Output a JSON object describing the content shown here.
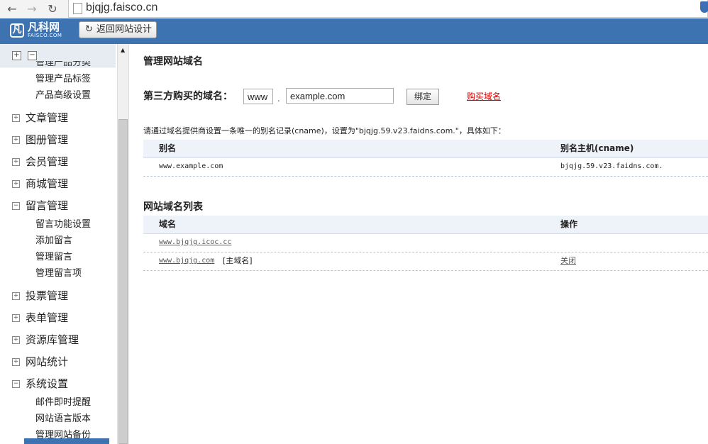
{
  "browser": {
    "url": "bjqjg.faisco.cn",
    "back_icon": "arrow-left-icon",
    "forward_icon": "arrow-right-icon",
    "reload_icon": "reload-icon"
  },
  "header": {
    "logo_text": "凡科网",
    "logo_sub": "FAISCO.COM",
    "back_button_label": "返回网站设计",
    "back_button_icon": "refresh-icon",
    "bar_color": "#3d73b0"
  },
  "sidebar": {
    "cut_item": "管理产品分类",
    "items": [
      {
        "type": "sub",
        "label": "管理产品标签"
      },
      {
        "type": "sub",
        "label": "产品高级设置"
      },
      {
        "type": "cat",
        "label": "文章管理",
        "toggle": "+"
      },
      {
        "type": "cat",
        "label": "图册管理",
        "toggle": "+"
      },
      {
        "type": "cat",
        "label": "会员管理",
        "toggle": "+"
      },
      {
        "type": "cat",
        "label": "商城管理",
        "toggle": "+"
      },
      {
        "type": "cat",
        "label": "留言管理",
        "toggle": "−"
      },
      {
        "type": "sub",
        "label": "留言功能设置"
      },
      {
        "type": "sub",
        "label": "添加留言"
      },
      {
        "type": "sub",
        "label": "管理留言"
      },
      {
        "type": "sub",
        "label": "管理留言项"
      },
      {
        "type": "cat",
        "label": "投票管理",
        "toggle": "+"
      },
      {
        "type": "cat",
        "label": "表单管理",
        "toggle": "+"
      },
      {
        "type": "cat",
        "label": "资源库管理",
        "toggle": "+"
      },
      {
        "type": "cat",
        "label": "网站统计",
        "toggle": "+"
      },
      {
        "type": "cat",
        "label": "系统设置",
        "toggle": "−"
      },
      {
        "type": "sub",
        "label": "邮件即时提醒"
      },
      {
        "type": "sub",
        "label": "网站语言版本"
      },
      {
        "type": "sub",
        "label": "管理网站备份"
      }
    ]
  },
  "main": {
    "title": "管理网站域名",
    "third_party": {
      "label": "第三方购买的域名：",
      "prefix_value": "www",
      "domain_value": "example.com",
      "bind_button": "绑定",
      "buy_link": "购买域名"
    },
    "note": "请通过域名提供商设置一条唯一的别名记录(cname)，设置为\"bjqjg.59.v23.faidns.com.\"，具体如下：",
    "cname_table": {
      "headers": [
        "别名",
        "别名主机(cname)"
      ],
      "rows": [
        [
          "www.example.com",
          "bjqjg.59.v23.faidns.com."
        ]
      ]
    },
    "domain_list": {
      "title": "网站域名列表",
      "headers": [
        "域名",
        "操作"
      ],
      "rows": [
        {
          "domain": "www.bjqjg.icoc.cc",
          "tag": "",
          "action": ""
        },
        {
          "domain": "www.bjqjg.com",
          "tag": "[主域名]",
          "action": "关闭"
        }
      ]
    }
  }
}
